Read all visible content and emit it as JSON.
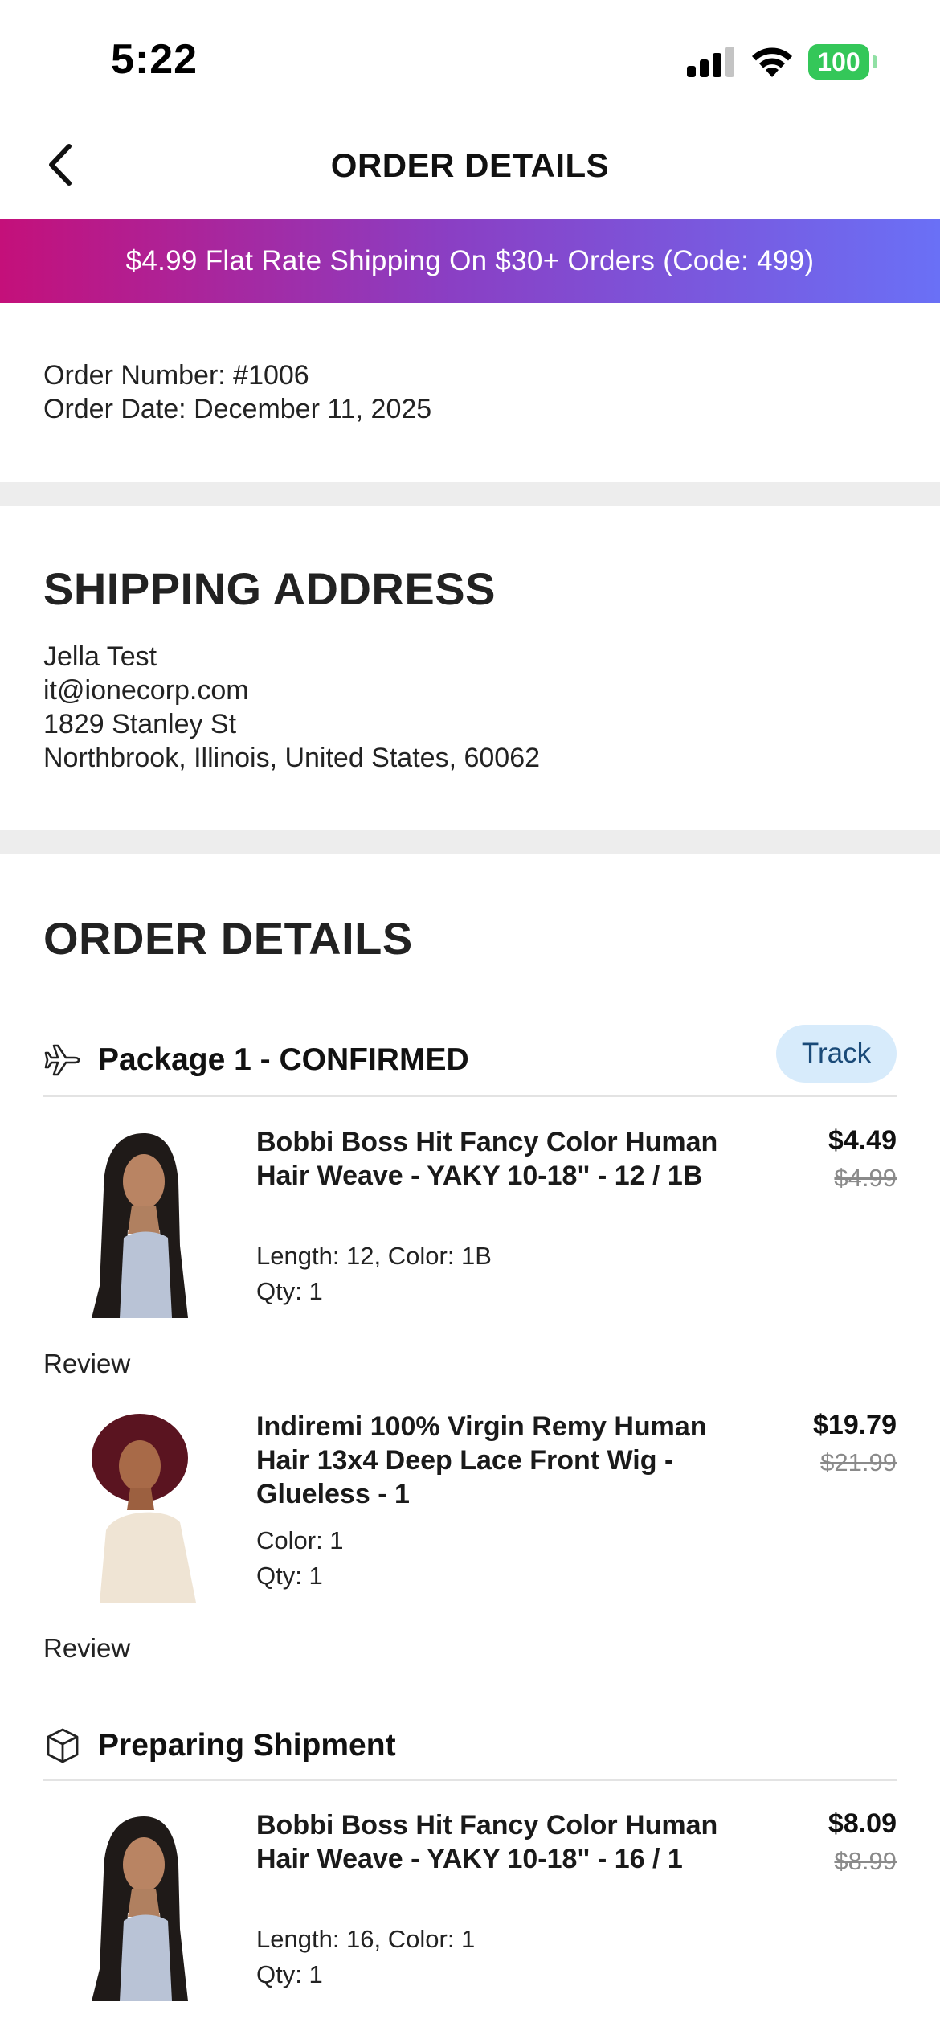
{
  "status_bar": {
    "time": "5:22",
    "battery": "100"
  },
  "header": {
    "title": "ORDER DETAILS"
  },
  "promo": {
    "text": "$4.99 Flat Rate Shipping On $30+ Orders (Code: 499)"
  },
  "order": {
    "number_line": "Order Number: #1006",
    "date_line": "Order Date: December 11, 2025"
  },
  "shipping": {
    "heading": "SHIPPING ADDRESS",
    "name": "Jella Test",
    "email": "it@ionecorp.com",
    "street": "1829 Stanley St",
    "city_line": "Northbrook, Illinois, United States, 60062"
  },
  "details": {
    "heading": "ORDER DETAILS"
  },
  "packages": [
    {
      "title": "Package 1 - CONFIRMED",
      "track_label": "Track",
      "items": [
        {
          "name": "Bobbi Boss Hit Fancy Color Human Hair Weave - YAKY 10-18\" - 12 / 1B",
          "variant": "Length: 12, Color: 1B",
          "qty": "Qty: 1",
          "price": "$4.49",
          "original_price": "$4.99",
          "review_label": "Review"
        },
        {
          "name": "Indiremi 100% Virgin Remy Human Hair 13x4 Deep Lace Front Wig - Glueless - 1",
          "variant": "Color: 1",
          "qty": "Qty: 1",
          "price": "$19.79",
          "original_price": "$21.99",
          "review_label": "Review"
        }
      ]
    },
    {
      "title": "Preparing Shipment",
      "items": [
        {
          "name": "Bobbi Boss Hit Fancy Color Human Hair Weave - YAKY 10-18\" - 16 / 1",
          "variant": "Length: 16, Color: 1",
          "qty": "Qty: 1",
          "price": "$8.09",
          "original_price": "$8.99"
        }
      ]
    }
  ],
  "colors": {
    "promo_start": "#c4107a",
    "promo_end": "#6a70f6",
    "track_bg": "#d7ebfb",
    "battery": "#34c759"
  }
}
